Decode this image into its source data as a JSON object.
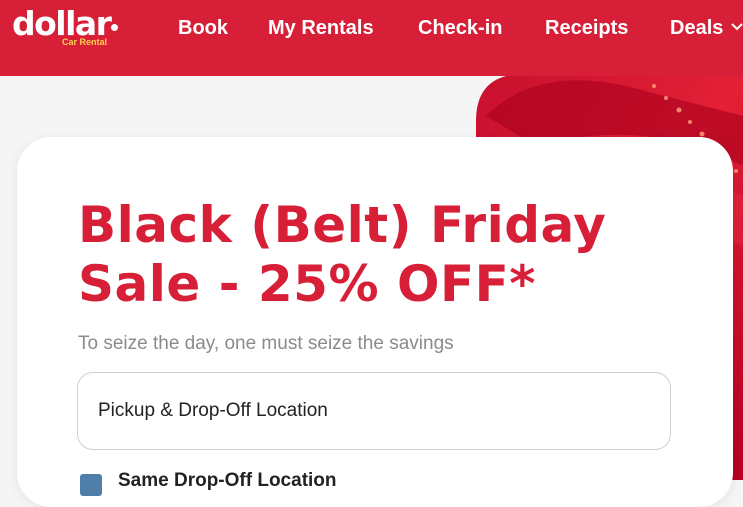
{
  "brand": {
    "name": "dollar",
    "subtitle": "Car Rental"
  },
  "nav": {
    "items": [
      "Book",
      "My Rentals",
      "Check-in",
      "Receipts",
      "Deals"
    ],
    "deals_icon": "chevron-down-icon"
  },
  "hero": {
    "headline_line1": "Black (Belt) Friday",
    "headline_line2": "Sale - 25% OFF*",
    "tagline": "To seize the day, one must seize the savings"
  },
  "booking": {
    "location_placeholder": "Pickup & Drop-Off Location",
    "same_location_label": "Same Drop-Off Location"
  },
  "colors": {
    "brand_red": "#d71f37",
    "logo_accent": "#ffd24d",
    "checkbox_blue": "#4f7ea8"
  }
}
